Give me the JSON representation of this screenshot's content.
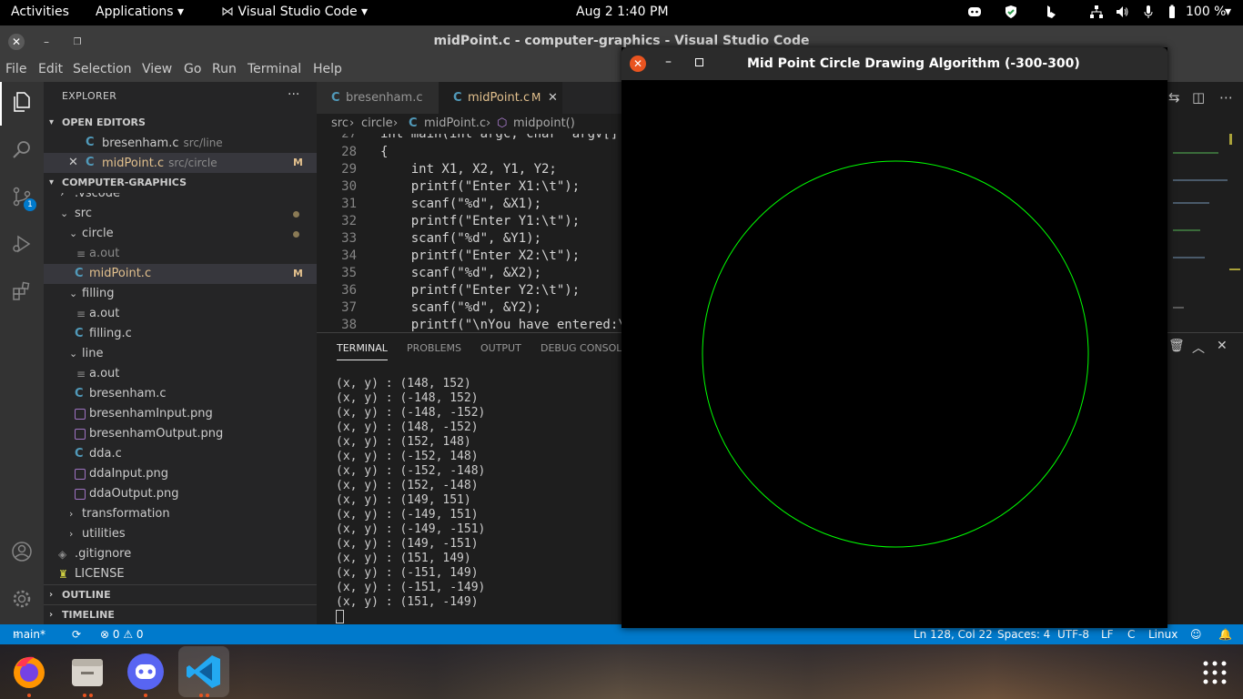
{
  "topbar": {
    "activities": "Activities",
    "applications": "Applications",
    "app_name": "Visual Studio Code",
    "datetime": "Aug 2   1:40 PM",
    "battery": "100 %"
  },
  "vscode": {
    "title": "midPoint.c - computer-graphics - Visual Studio Code",
    "menu": [
      "File",
      "Edit",
      "Selection",
      "View",
      "Go",
      "Run",
      "Terminal",
      "Help"
    ],
    "explorer_title": "EXPLORER",
    "explorer_more": "···",
    "open_editors_header": "OPEN EDITORS",
    "open_editors": [
      {
        "name": "bresenham.c",
        "path": "src/line",
        "modified": ""
      },
      {
        "name": "midPoint.c",
        "path": "src/circle",
        "modified": "M"
      }
    ],
    "workspace_header": "COMPUTER-GRAPHICS",
    "tree": [
      {
        "label": ".vscode"
      },
      {
        "label": "src"
      },
      {
        "label": "circle"
      },
      {
        "label": "a.out"
      },
      {
        "label": "midPoint.c",
        "badge": "M"
      },
      {
        "label": "filling"
      },
      {
        "label": "a.out"
      },
      {
        "label": "filling.c"
      },
      {
        "label": "line"
      },
      {
        "label": "a.out"
      },
      {
        "label": "bresenham.c"
      },
      {
        "label": "bresenhamInput.png"
      },
      {
        "label": "bresenhamOutput.png"
      },
      {
        "label": "dda.c"
      },
      {
        "label": "ddaInput.png"
      },
      {
        "label": "ddaOutput.png"
      },
      {
        "label": "transformation"
      },
      {
        "label": "utilities"
      },
      {
        "label": ".gitignore"
      },
      {
        "label": "LICENSE"
      }
    ],
    "outline_header": "OUTLINE",
    "timeline_header": "TIMELINE",
    "scm_badge": "1",
    "tabs": [
      {
        "label": "bresenham.c"
      },
      {
        "label": "midPoint.c",
        "badge": "M"
      }
    ],
    "breadcrumb": [
      "src",
      "circle",
      "midPoint.c",
      "midpoint()"
    ],
    "code_lines": [
      {
        "n": "27",
        "text": "int main(int argc, char *argv[]"
      },
      {
        "n": "28",
        "text": "{"
      },
      {
        "n": "29",
        "text": "    int X1, X2, Y1, Y2;"
      },
      {
        "n": "30",
        "text": "    printf(\"Enter X1:\\t\");"
      },
      {
        "n": "31",
        "text": "    scanf(\"%d\", &X1);"
      },
      {
        "n": "32",
        "text": "    printf(\"Enter Y1:\\t\");"
      },
      {
        "n": "33",
        "text": "    scanf(\"%d\", &Y1);"
      },
      {
        "n": "34",
        "text": "    printf(\"Enter X2:\\t\");"
      },
      {
        "n": "35",
        "text": "    scanf(\"%d\", &X2);"
      },
      {
        "n": "36",
        "text": "    printf(\"Enter Y2:\\t\");"
      },
      {
        "n": "37",
        "text": "    scanf(\"%d\", &Y2);"
      },
      {
        "n": "38",
        "text": "    printf(\"\\nYou have entered:\\"
      }
    ],
    "panel_tabs": [
      "TERMINAL",
      "PROBLEMS",
      "OUTPUT",
      "DEBUG CONSOLE"
    ],
    "terminal_lines": [
      "(x, y) : (148, 152)",
      "(x, y) : (-148, 152)",
      "(x, y) : (-148, -152)",
      "(x, y) : (148, -152)",
      "(x, y) : (152, 148)",
      "(x, y) : (-152, 148)",
      "(x, y) : (-152, -148)",
      "(x, y) : (152, -148)",
      "(x, y) : (149, 151)",
      "(x, y) : (-149, 151)",
      "(x, y) : (-149, -151)",
      "(x, y) : (149, -151)",
      "(x, y) : (151, 149)",
      "(x, y) : (-151, 149)",
      "(x, y) : (-151, -149)",
      "(x, y) : (151, -149)"
    ],
    "status": {
      "branch": "main*",
      "problems": "⊗ 0 ⚠ 0",
      "position": "Ln 128, Col 22",
      "spaces": "Spaces: 4",
      "encoding": "UTF-8",
      "eol": "LF",
      "language": "C",
      "os": "Linux"
    }
  },
  "graphics_window": {
    "title": "Mid Point Circle Drawing Algorithm (-300-300)",
    "circle_color": "#00ff00",
    "background": "#000000",
    "circle_radius_units": 212
  },
  "colors": {
    "accent": "#007acc",
    "ubuntu_orange": "#e95420",
    "modified": "#e2c08d"
  }
}
